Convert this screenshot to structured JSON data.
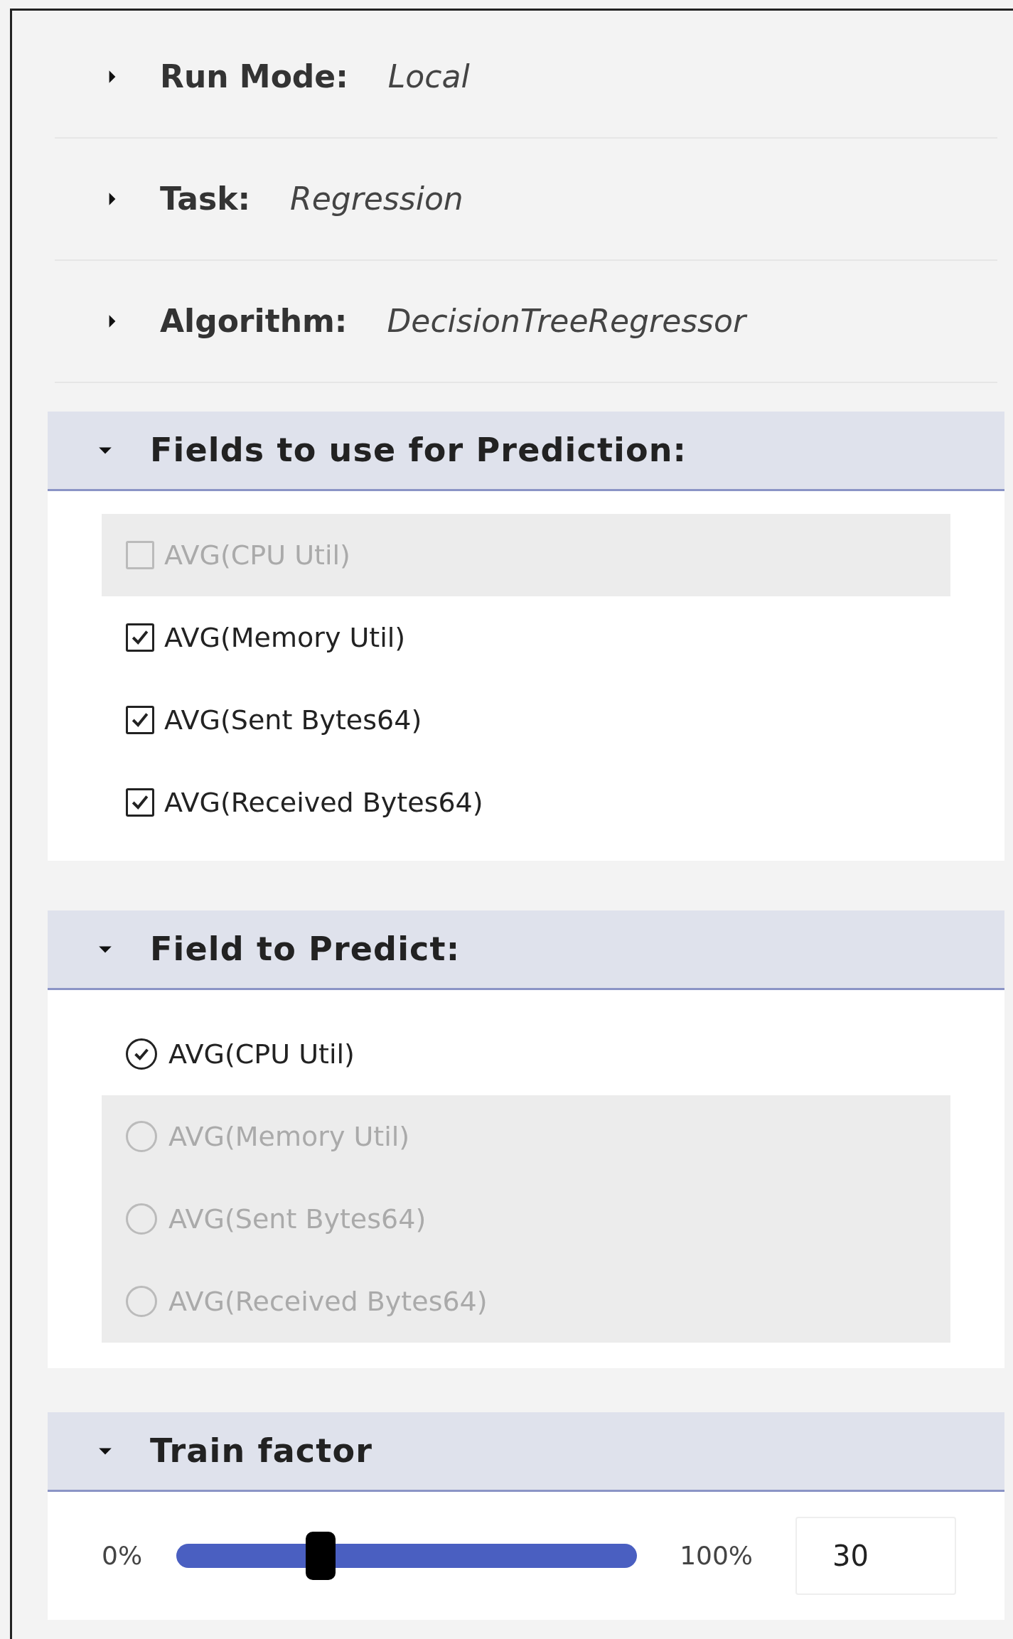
{
  "settings": [
    {
      "label": "Run Mode:",
      "value": "Local",
      "expanded": false
    },
    {
      "label": "Task:",
      "value": "Regression",
      "expanded": false
    },
    {
      "label": "Algorithm:",
      "value": "DecisionTreeRegressor",
      "expanded": false
    }
  ],
  "prediction_fields": {
    "title": "Fields to use for Prediction:",
    "expanded": true,
    "items": [
      {
        "label": "AVG(CPU Util)",
        "checked": false,
        "disabled": true
      },
      {
        "label": "AVG(Memory Util)",
        "checked": true,
        "disabled": false
      },
      {
        "label": "AVG(Sent Bytes64)",
        "checked": true,
        "disabled": false
      },
      {
        "label": "AVG(Received Bytes64)",
        "checked": true,
        "disabled": false
      }
    ]
  },
  "field_to_predict": {
    "title": "Field to Predict:",
    "expanded": true,
    "items": [
      {
        "label": "AVG(CPU Util)",
        "selected": true
      },
      {
        "label": "AVG(Memory Util)",
        "selected": false
      },
      {
        "label": "AVG(Sent Bytes64)",
        "selected": false
      },
      {
        "label": "AVG(Received Bytes64)",
        "selected": false
      }
    ]
  },
  "train_factor": {
    "title": "Train factor",
    "expanded": true,
    "min_label": "0%",
    "max_label": "100%",
    "level": 0.3,
    "value": "30"
  }
}
